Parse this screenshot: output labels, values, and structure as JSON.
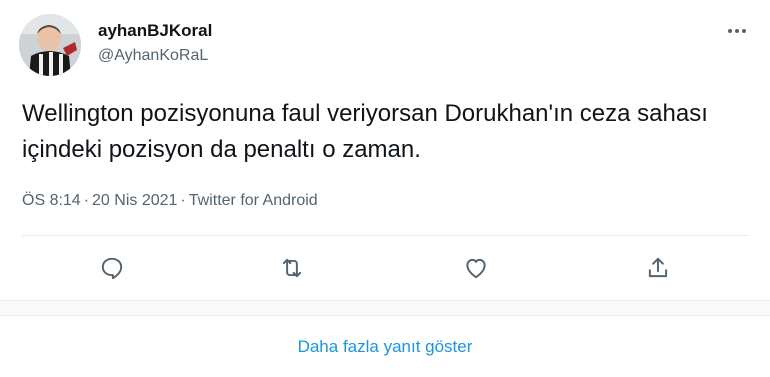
{
  "author": {
    "display_name": "ayhanBJKoral",
    "handle": "@AyhanKoRaL",
    "avatar_icon": "user-avatar-child-jersey"
  },
  "tweet": {
    "text": "Wellington pozisyonuna faul veriyorsan Dorukhan'ın ceza sahası içindeki pozisyon da penaltı o zaman.",
    "time": "ÖS 8:14",
    "date": "20 Nis 2021",
    "source": "Twitter for Android",
    "separator": "·"
  },
  "actions": [
    {
      "icon": "reply-icon"
    },
    {
      "icon": "retweet-icon"
    },
    {
      "icon": "like-icon"
    },
    {
      "icon": "share-icon"
    }
  ],
  "more_replies_label": "Daha fazla yanıt göster",
  "colors": {
    "text": "#0f1419",
    "secondary": "#536471",
    "accent": "#1b95e0",
    "divider": "#e6ecf0"
  }
}
